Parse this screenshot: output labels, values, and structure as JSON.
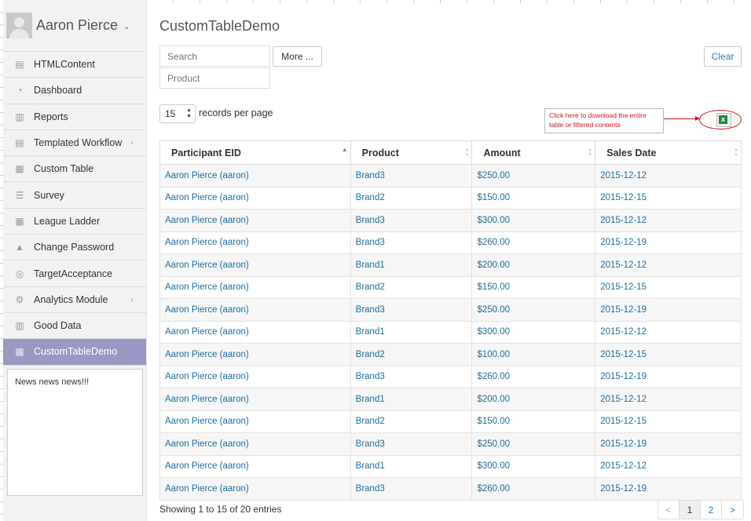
{
  "user": {
    "name": "Aaron Pierce"
  },
  "sidebar": {
    "items": [
      {
        "label": "HTMLContent",
        "icon": "file-icon",
        "glyph": "▤",
        "chevron": false,
        "active": false
      },
      {
        "label": "Dashboard",
        "icon": "dashboard-icon",
        "glyph": "◔",
        "chevron": false,
        "active": false
      },
      {
        "label": "Reports",
        "icon": "bar-chart-icon",
        "glyph": "▥",
        "chevron": false,
        "active": false
      },
      {
        "label": "Templated Workflow",
        "icon": "file-icon",
        "glyph": "▤",
        "chevron": true,
        "active": false
      },
      {
        "label": "Custom Table",
        "icon": "table-icon",
        "glyph": "▦",
        "chevron": false,
        "active": false
      },
      {
        "label": "Survey",
        "icon": "list-icon",
        "glyph": "☰",
        "chevron": false,
        "active": false
      },
      {
        "label": "League Ladder",
        "icon": "table-icon",
        "glyph": "▦",
        "chevron": false,
        "active": false
      },
      {
        "label": "Change Password",
        "icon": "lock-icon",
        "glyph": "▲",
        "chevron": false,
        "active": false
      },
      {
        "label": "TargetAcceptance",
        "icon": "target-icon",
        "glyph": "◎",
        "chevron": false,
        "active": false
      },
      {
        "label": "Analytics Module",
        "icon": "gears-icon",
        "glyph": "⚙",
        "chevron": true,
        "active": false
      },
      {
        "label": "Good Data",
        "icon": "bar-chart-icon",
        "glyph": "▥",
        "chevron": false,
        "active": false
      },
      {
        "label": "CustomTableDemo",
        "icon": "table-icon",
        "glyph": "▦",
        "chevron": false,
        "active": true
      }
    ]
  },
  "news": {
    "text": "News news news!!!"
  },
  "page": {
    "title": "CustomTableDemo",
    "search_placeholder": "Search",
    "product_placeholder": "Product",
    "more_label": "More ...",
    "clear_label": "Clear",
    "per_page_value": "15",
    "per_page_label": "records per page",
    "callout_text": "Click here to download the entire table or filtered contents",
    "showing": "Showing 1 to 15 of 20 entries"
  },
  "table": {
    "headers": [
      "Participant EID",
      "Product",
      "Amount",
      "Sales Date"
    ],
    "rows": [
      [
        "Aaron Pierce (aaron)",
        "Brand3",
        "$250.00",
        "2015-12-12"
      ],
      [
        "Aaron Pierce (aaron)",
        "Brand2",
        "$150.00",
        "2015-12-15"
      ],
      [
        "Aaron Pierce (aaron)",
        "Brand3",
        "$300.00",
        "2015-12-12"
      ],
      [
        "Aaron Pierce (aaron)",
        "Brand3",
        "$260.00",
        "2015-12-19"
      ],
      [
        "Aaron Pierce (aaron)",
        "Brand1",
        "$200.00",
        "2015-12-12"
      ],
      [
        "Aaron Pierce (aaron)",
        "Brand2",
        "$150.00",
        "2015-12-15"
      ],
      [
        "Aaron Pierce (aaron)",
        "Brand3",
        "$250.00",
        "2015-12-19"
      ],
      [
        "Aaron Pierce (aaron)",
        "Brand1",
        "$300.00",
        "2015-12-12"
      ],
      [
        "Aaron Pierce (aaron)",
        "Brand2",
        "$100.00",
        "2015-12-15"
      ],
      [
        "Aaron Pierce (aaron)",
        "Brand3",
        "$260.00",
        "2015-12-19"
      ],
      [
        "Aaron Pierce (aaron)",
        "Brand1",
        "$200.00",
        "2015-12-12"
      ],
      [
        "Aaron Pierce (aaron)",
        "Brand2",
        "$150.00",
        "2015-12-15"
      ],
      [
        "Aaron Pierce (aaron)",
        "Brand3",
        "$250.00",
        "2015-12-19"
      ],
      [
        "Aaron Pierce (aaron)",
        "Brand1",
        "$300.00",
        "2015-12-12"
      ],
      [
        "Aaron Pierce (aaron)",
        "Brand3",
        "$260.00",
        "2015-12-19"
      ]
    ]
  },
  "pagination": {
    "prev": "<",
    "pages": [
      "1",
      "2"
    ],
    "current": "1",
    "next": ">"
  },
  "colors": {
    "accent": "#9a99c3",
    "link": "#1e6e9f",
    "callout": "#d0161c"
  }
}
